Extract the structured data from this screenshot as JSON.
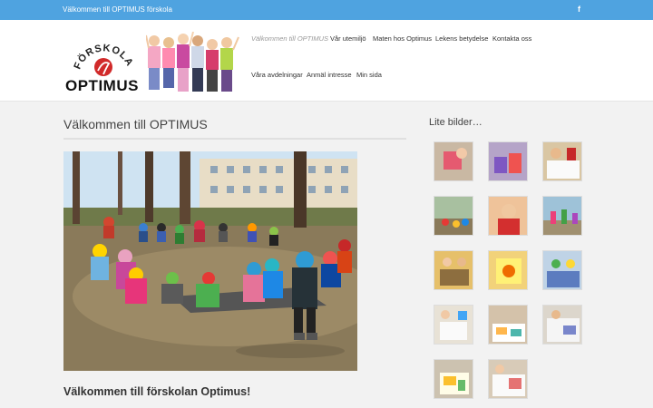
{
  "topbar": {
    "welcome": "Välkommen till OPTIMUS förskola",
    "facebook_icon": "f"
  },
  "logo": {
    "arc_text": "FÖRSKOLAN",
    "name": "OPTIMUS"
  },
  "nav": {
    "items": [
      {
        "label": "Välkommen till OPTIMUS",
        "active": true
      },
      {
        "label": "Vår utemiljö"
      },
      {
        "label": "Maten hos Optimus"
      },
      {
        "label": "Lekens betydelse"
      },
      {
        "label": "Kontakta oss"
      },
      {
        "label": "Våra avdelningar"
      },
      {
        "label": "Anmäl intresse"
      },
      {
        "label": "Min sida"
      }
    ]
  },
  "main": {
    "title": "Välkommen till OPTIMUS",
    "subtitle": "Välkommen till förskolan Optimus!"
  },
  "sidebar": {
    "title": "Lite bilder…",
    "thumb_count": 14
  },
  "colors": {
    "topbar": "#4fa3e0",
    "logo_red": "#d12a2a",
    "nav_active": "#999999"
  }
}
